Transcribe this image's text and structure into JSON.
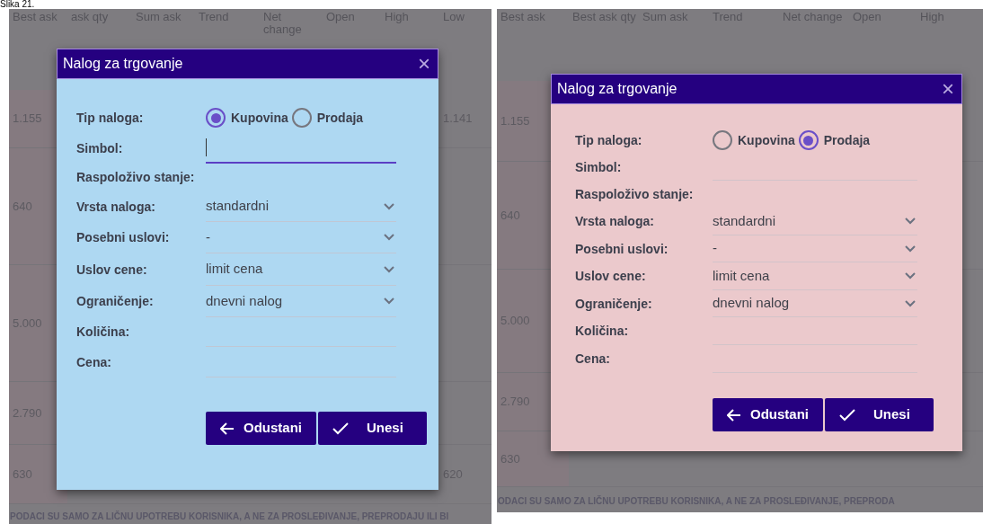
{
  "caption": "Slika 21.",
  "panels": [
    {
      "columns": [
        "Best ask",
        "ask qty",
        "Sum ask",
        "Trend",
        "Net change",
        "Open",
        "High",
        "Low"
      ],
      "rows": [
        {
          "cells": [
            "1.155",
            "",
            "",
            "",
            "",
            "",
            "",
            "1.141"
          ]
        },
        {
          "cells": [
            "640",
            "",
            "",
            "",
            "",
            "",
            "",
            ""
          ]
        },
        {
          "cells": [
            "5.000",
            "",
            "",
            "",
            "",
            "",
            "",
            ""
          ]
        },
        {
          "cells": [
            "2.790",
            "",
            "",
            "",
            "",
            "",
            "",
            ""
          ]
        },
        {
          "cells": [
            "630",
            "",
            "",
            "",
            "",
            "",
            "",
            "620"
          ]
        }
      ],
      "notice": "PODACI SU SAMO ZA LIČNU UPOTREBU KORISNIKA, A NE ZA PROSLEĐIVANJE, PREPRODAJU ILI BI",
      "dialog": {
        "title": "Nalog za trgovanje",
        "close": "×",
        "fields": [
          {
            "kind": "radio",
            "label": "Tip naloga:",
            "options": [
              {
                "label": "Kupovina",
                "selected": true
              },
              {
                "label": "Prodaja",
                "selected": false
              }
            ]
          },
          {
            "kind": "input",
            "label": "Simbol:",
            "focused": true
          },
          {
            "kind": "text",
            "label": "Raspoloživo stanje:"
          },
          {
            "kind": "select",
            "label": "Vrsta naloga:",
            "value": "standardni"
          },
          {
            "kind": "select",
            "label": "Posebni uslovi:",
            "value": "-"
          },
          {
            "kind": "select",
            "label": "Uslov cene:",
            "value": "limit cena"
          },
          {
            "kind": "select",
            "label": "Ograničenje:",
            "value": "dnevni nalog"
          },
          {
            "kind": "input",
            "label": "Količina:",
            "focused": false
          },
          {
            "kind": "input",
            "label": "Cena:",
            "focused": false
          }
        ],
        "buttons": [
          {
            "kind": "back",
            "label": "Odustani"
          },
          {
            "kind": "confirm",
            "label": "Unesi"
          }
        ]
      }
    },
    {
      "columns": [
        "Best ask",
        "Best ask qty",
        "Sum ask",
        "Trend",
        "Net change",
        "Open",
        "High"
      ],
      "rows": [
        {
          "cells": [
            "1.155",
            "",
            "",
            "",
            "",
            "",
            ""
          ]
        },
        {
          "cells": [
            "640",
            "",
            "",
            "",
            "",
            "",
            ""
          ]
        },
        {
          "cells": [
            "5.000",
            "",
            "",
            "",
            "",
            "",
            ""
          ]
        },
        {
          "cells": [
            "2.790",
            "",
            "",
            "",
            "",
            "",
            ""
          ]
        },
        {
          "cells": [
            "630",
            "",
            "",
            "",
            "",
            "",
            ""
          ]
        }
      ],
      "notice": "ODACI SU SAMO ZA LIČNU UPOTREBU KORISNIKA, A NE ZA PROSLEĐIVANJE, PREPRODA",
      "dialog": {
        "title": "Nalog za trgovanje",
        "close": "×",
        "fields": [
          {
            "kind": "radio",
            "label": "Tip naloga:",
            "options": [
              {
                "label": "Kupovina",
                "selected": false
              },
              {
                "label": "Prodaja",
                "selected": true
              }
            ]
          },
          {
            "kind": "input",
            "label": "Simbol:",
            "focused": false
          },
          {
            "kind": "text",
            "label": "Raspoloživo stanje:"
          },
          {
            "kind": "select",
            "label": "Vrsta naloga:",
            "value": "standardni"
          },
          {
            "kind": "select",
            "label": "Posebni uslovi:",
            "value": "-"
          },
          {
            "kind": "select",
            "label": "Uslov cene:",
            "value": "limit cena"
          },
          {
            "kind": "select",
            "label": "Ograničenje:",
            "value": "dnevni nalog"
          },
          {
            "kind": "input",
            "label": "Količina:",
            "focused": false
          },
          {
            "kind": "input",
            "label": "Cena:",
            "focused": false
          }
        ],
        "buttons": [
          {
            "kind": "back",
            "label": "Odustani"
          },
          {
            "kind": "confirm",
            "label": "Unesi"
          }
        ]
      }
    }
  ]
}
